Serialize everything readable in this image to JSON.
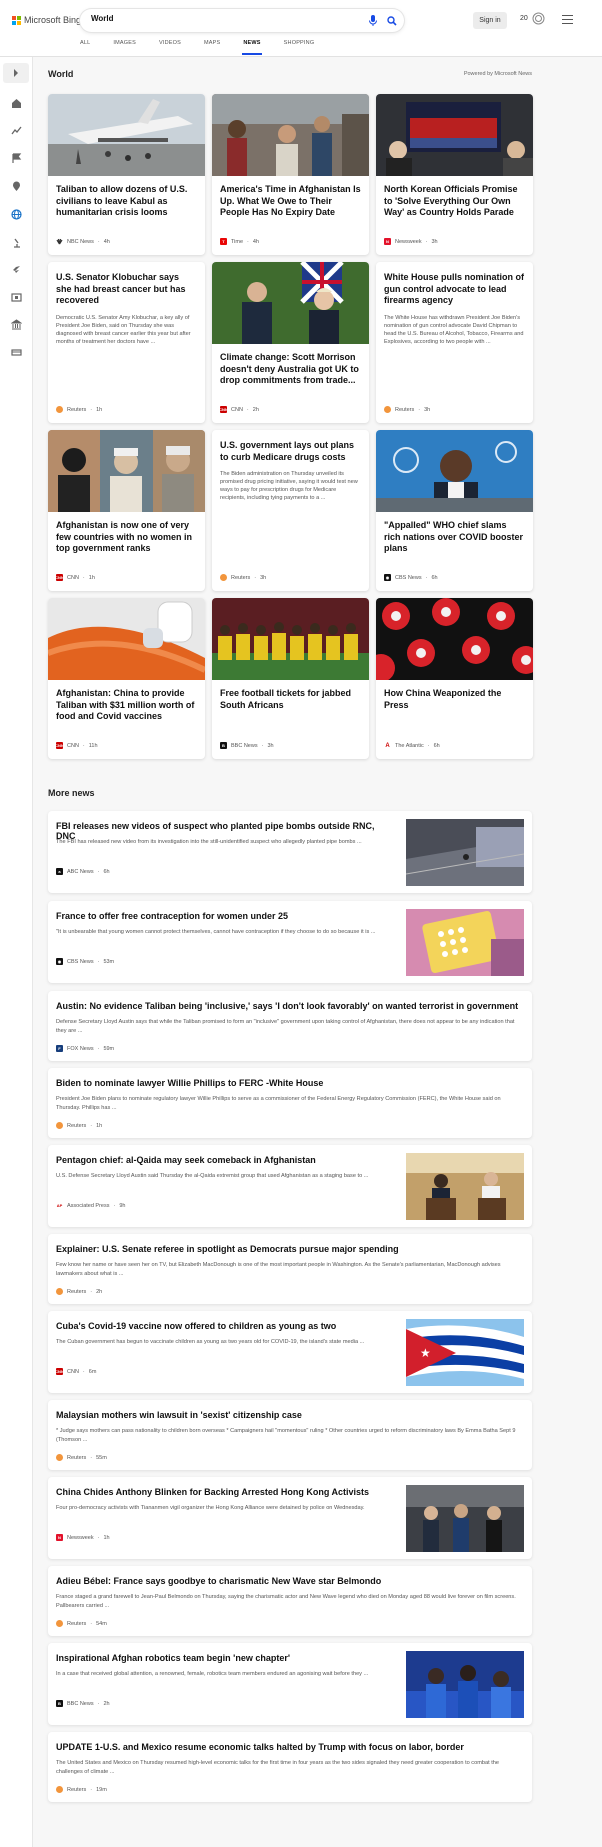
{
  "header": {
    "brand": "Microsoft Bing",
    "query": "World",
    "signin": "Sign in",
    "rewards_count": "20",
    "tabs": [
      "ALL",
      "IMAGES",
      "VIDEOS",
      "MAPS",
      "NEWS",
      "SHOPPING"
    ],
    "active_tab": "NEWS"
  },
  "section": {
    "title": "World",
    "powered": "Powered by Microsoft News"
  },
  "cards": [
    {
      "title": "Taliban to allow dozens of U.S. civilians to leave Kabul as humanitarian crisis looms",
      "snippet": "",
      "source": "NBC News",
      "time": "4h"
    },
    {
      "title": "America's Time in Afghanistan Is Up. What We Owe to Their People Has No Expiry Date",
      "snippet": "",
      "source": "Time",
      "time": "4h"
    },
    {
      "title": "North Korean Officials Promise to 'Solve Everything Our Own Way' as Country Holds Parade",
      "snippet": "",
      "source": "Newsweek",
      "time": "3h"
    },
    {
      "title": "U.S. Senator Klobuchar says she had breast cancer but has recovered",
      "snippet": "Democratic U.S. Senator Amy Klobuchar, a key ally of President Joe Biden, said on Thursday she was diagnosed with breast cancer earlier this year but after months of treatment her doctors have ...",
      "source": "Reuters",
      "time": "1h"
    },
    {
      "title": "Climate change: Scott Morrison doesn't deny Australia got UK to drop commitments from trade...",
      "snippet": "",
      "source": "CNN",
      "time": "2h"
    },
    {
      "title": "White House pulls nomination of gun control advocate to lead firearms agency",
      "snippet": "The White House has withdrawn President Joe Biden's nomination of gun control advocate David Chipman to head the U.S. Bureau of Alcohol, Tobacco, Firearms and Explosives, according to two people with ...",
      "source": "Reuters",
      "time": "3h"
    },
    {
      "title": "Afghanistan is now one of very few countries with no women in top government ranks",
      "snippet": "",
      "source": "CNN",
      "time": "1h"
    },
    {
      "title": "U.S. government lays out plans to curb Medicare drugs costs",
      "snippet": "The Biden administration on Thursday unveiled its promised drug pricing initiative, saying it would test new ways to pay for prescription drugs for Medicare recipients, including tying payments to a ...",
      "source": "Reuters",
      "time": "3h"
    },
    {
      "title": "\"Appalled\" WHO chief slams rich nations over COVID booster plans",
      "snippet": "",
      "source": "CBS News",
      "time": "6h"
    },
    {
      "title": "Afghanistan: China to provide Taliban with $31 million worth of food and Covid vaccines",
      "snippet": "",
      "source": "CNN",
      "time": "11h"
    },
    {
      "title": "Free football tickets for jabbed South Africans",
      "snippet": "",
      "source": "BBC News",
      "time": "3h"
    },
    {
      "title": "How China Weaponized the Press",
      "snippet": "",
      "source": "The Atlantic",
      "time": "6h"
    }
  ],
  "more_news_title": "More news",
  "more_news": [
    {
      "title": "FBI releases new videos of suspect who planted pipe bombs outside RNC, DNC",
      "snippet": "The FBI has released new video from its investigation into the still-unidentified suspect who allegedly planted pipe bombs ...",
      "source": "ABC News",
      "time": "6h"
    },
    {
      "title": "France to offer free contraception for women under 25",
      "snippet": "\"It is unbearable that young women cannot protect themselves, cannot have contraception if they choose to do so because it is ...",
      "source": "CBS News",
      "time": "53m"
    },
    {
      "title": "Austin: No evidence Taliban being 'inclusive,' says 'I don't look favorably' on wanted terrorist in government",
      "snippet": "Defense Secretary Lloyd Austin says that while the Taliban promised to form an \"inclusive\" government upon taking control of Afghanistan, there does not appear to be any indication that they are ...",
      "source": "FOX News",
      "time": "59m"
    },
    {
      "title": "Biden to nominate lawyer Willie Phillips to FERC -White House",
      "snippet": "President Joe Biden plans to nominate regulatory lawyer Willie Phillips to serve as a commissioner of the Federal Energy Regulatory Commission (FERC), the White House said on Thursday. Phillips has ...",
      "source": "Reuters",
      "time": "1h"
    },
    {
      "title": "Pentagon chief: al-Qaida may seek comeback in Afghanistan",
      "snippet": "U.S. Defense Secretary Lloyd Austin said Thursday the al-Qaida extremist group that used Afghanistan as a staging base to ...",
      "source": "Associated Press",
      "time": "9h"
    },
    {
      "title": "Explainer: U.S. Senate referee in spotlight as Democrats pursue major spending",
      "snippet": "Few know her name or have seen her on TV, but Elizabeth MacDonough is one of the most important people in Washington. As the Senate's parliamentarian, MacDonough advises lawmakers about what is ...",
      "source": "Reuters",
      "time": "2h"
    },
    {
      "title": "Cuba's Covid-19 vaccine now offered to children as young as two",
      "snippet": "The Cuban government has begun to vaccinate children as young as two years old for COVID-19, the island's state media ...",
      "source": "CNN",
      "time": "6m"
    },
    {
      "title": "Malaysian mothers win lawsuit in 'sexist' citizenship case",
      "snippet": "* Judge says mothers can pass nationality to children born overseas * Campaigners hail \"momentous\" ruling * Other countries urged to reform discriminatory laws By Emma Batha Sept 9 (Thomson ...",
      "source": "Reuters",
      "time": "55m"
    },
    {
      "title": "China Chides Anthony Blinken for Backing Arrested Hong Kong Activists",
      "snippet": "Four pro-democracy activists with Tiananmen vigil organizer the Hong Kong Alliance were detained by police on Wednesday.",
      "source": "Newsweek",
      "time": "1h"
    },
    {
      "title": "Adieu Bébel: France says goodbye to charismatic New Wave star Belmondo",
      "snippet": "France staged a grand farewell to Jean-Paul Belmondo on Thursday, saying the charismatic actor and New Wave legend who died on Monday aged 88 would live forever on film screens. Pallbearers carried ...",
      "source": "Reuters",
      "time": "54m"
    },
    {
      "title": "Inspirational Afghan robotics team begin 'new chapter'",
      "snippet": "In a case that received global attention, a renowned, female, robotics team members endured an agonising wait before they ...",
      "source": "BBC News",
      "time": "2h"
    },
    {
      "title": "UPDATE 1-U.S. and Mexico resume economic talks halted by Trump with focus on labor, border",
      "snippet": "The United States and Mexico on Thursday resumed high-level economic talks for the first time in four years as the two sides signaled they need greater cooperation to combat the challenges of climate ...",
      "source": "Reuters",
      "time": "19m"
    }
  ],
  "colors": {
    "accent": "#174ae4",
    "reuters": "#f2953c",
    "cnn": "#cc0000",
    "newsweek": "#e3122b",
    "time": "#e90606"
  }
}
